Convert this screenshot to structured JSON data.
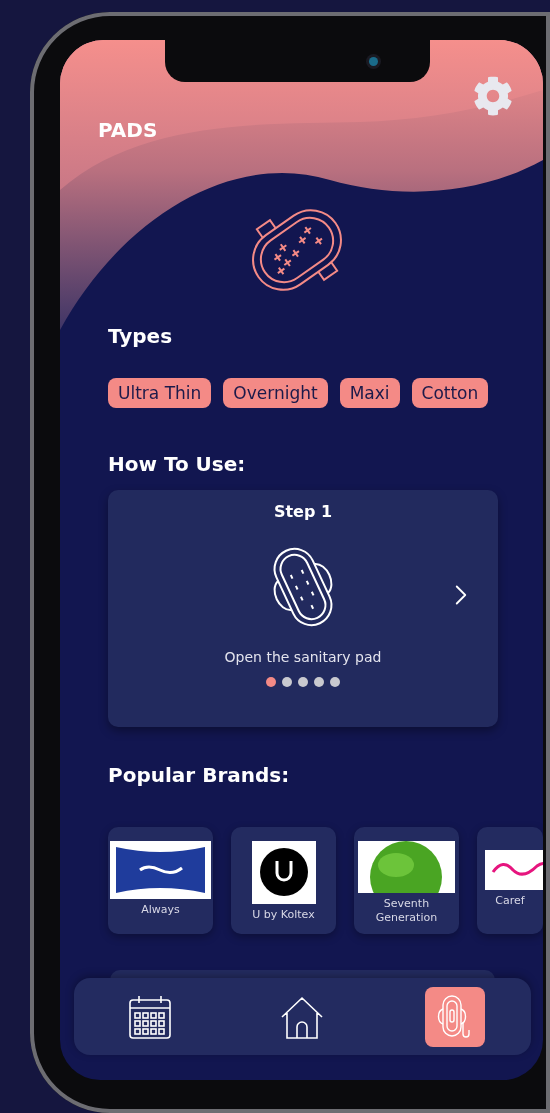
{
  "screen": {
    "title": "PADS"
  },
  "types": {
    "heading": "Types",
    "chips": [
      {
        "label": "Ultra Thin"
      },
      {
        "label": "Overnight"
      },
      {
        "label": "Maxi"
      },
      {
        "label": "Cotton"
      }
    ]
  },
  "how_to_use": {
    "heading": "How To Use:",
    "step_title": "Step 1",
    "caption": "Open the sanitary pad",
    "dots": [
      {
        "selected": true
      },
      {
        "selected": false
      },
      {
        "selected": false
      },
      {
        "selected": false
      },
      {
        "selected": false
      }
    ]
  },
  "popular_brands": {
    "heading": "Popular Brands:",
    "brands": [
      {
        "name": "Always",
        "kind": "banner"
      },
      {
        "name": "U by Koltex",
        "kind": "circle"
      },
      {
        "name": "Seventh Generation",
        "kind": "leaf"
      },
      {
        "name": "Caref",
        "kind": "wordmark"
      }
    ]
  },
  "nav": [
    {
      "kind": "calendar",
      "selected": false
    },
    {
      "kind": "home",
      "selected": false
    },
    {
      "kind": "pad",
      "selected": true
    }
  ]
}
